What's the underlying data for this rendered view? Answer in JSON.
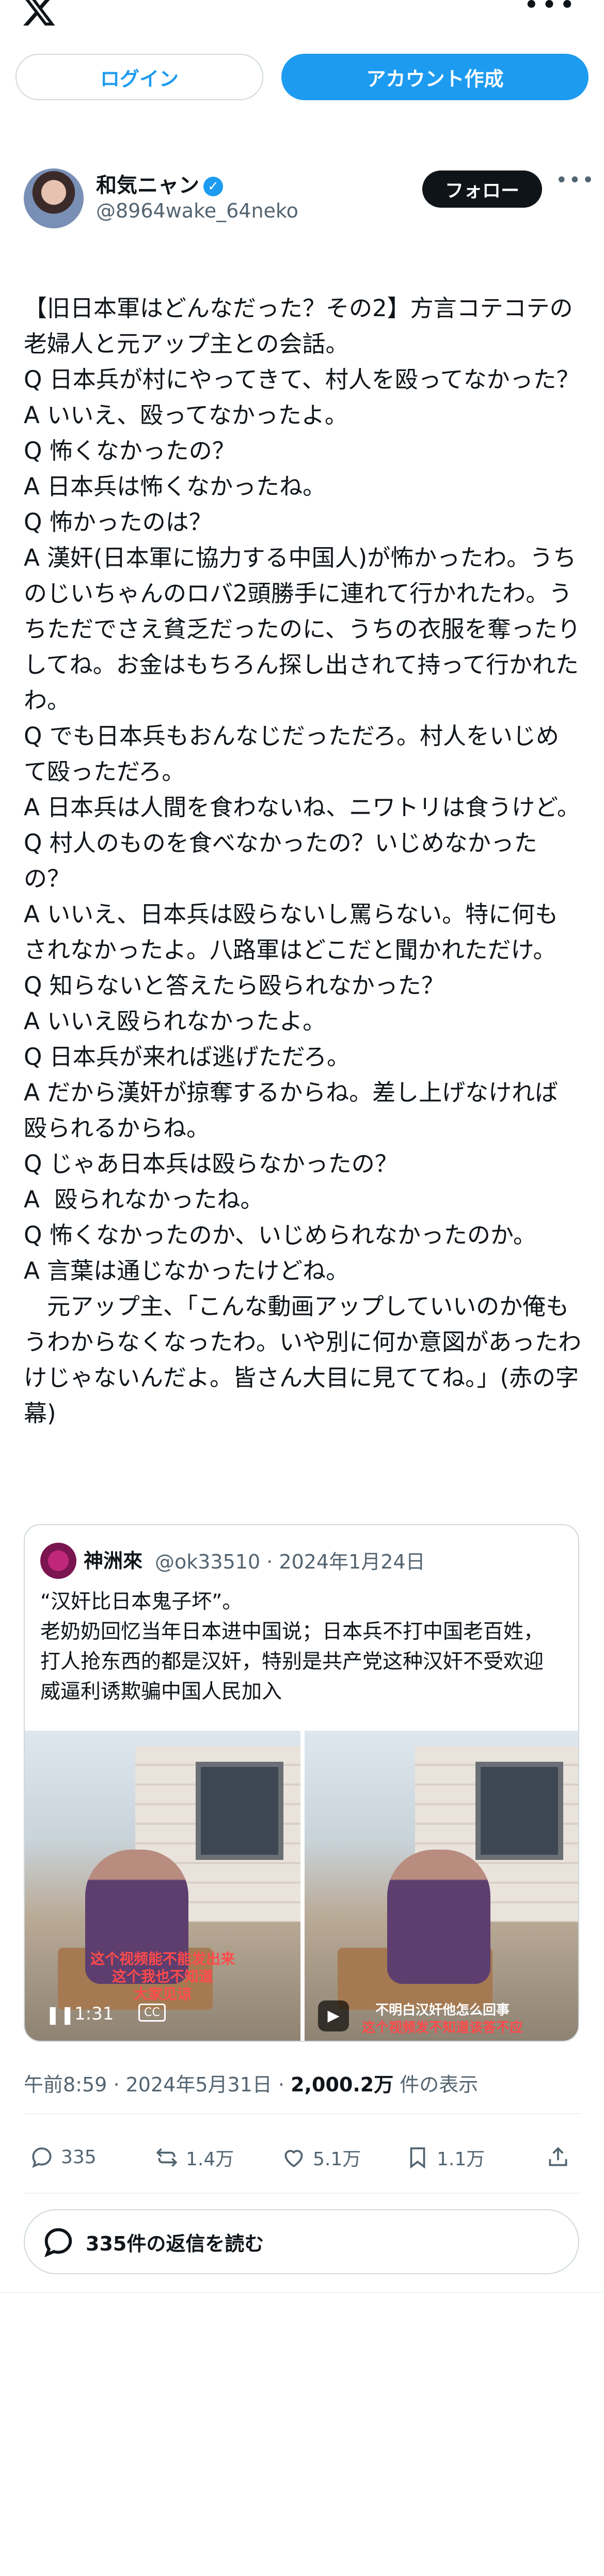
{
  "header": {
    "logo_icon": "x-logo",
    "more_icon": "more-horizontal-icon",
    "login_label": "ログイン",
    "signup_label": "アカウント作成"
  },
  "post": {
    "author_name": "和気ニャン",
    "author_handle": "@8964wake_64neko",
    "verified_icon": "verified-badge-icon",
    "follow_label": "フォロー",
    "more_icon": "more-horizontal-icon",
    "text": "【旧日本軍はどんなだった？その2】方言コテコテの老婦人と元アップ主との会話。\nQ 日本兵が村にやってきて、村人を殴ってなかった？\nA いいえ、殴ってなかったよ。\nQ 怖くなかったの？\nA 日本兵は怖くなかったね。\nQ 怖かったのは？\nA 漢奸(日本軍に協力する中国人)が怖かったわ。うちのじいちゃんのロバ2頭勝手に連れて行かれたわ。うちただでさえ貧乏だったのに、うちの衣服を奪ったりしてね。お金はもちろん探し出されて持って行かれたわ。\nQ でも日本兵もおんなじだっただろ。村人をいじめて殴っただろ。\nA 日本兵は人間を食わないね、ニワトリは食うけど。\nQ 村人のものを食べなかったの？いじめなかったの？\nA いいえ、日本兵は殴らないし罵らない。特に何もされなかったよ。八路軍はどこだと聞かれただけ。\nQ 知らないと答えたら殴られなかった？\nA いいえ殴られなかったよ。\nQ 日本兵が来れば逃げただろ。\nA だから漢奸が掠奪するからね。差し上げなければ殴られるからね。\nQ じゃあ日本兵は殴らなかったの？\nA  殴られなかったね。\nQ 怖くなかったのか、いじめられなかったのか。\nA 言葉は通じなかったけどね。\n　元アップ主、「こんな動画アップしていいのか俺もうわからなくなったわ。いや別に何か意図があったわけじゃないんだよ。皆さん大目に見ててね。」(赤の字幕)",
    "quote": {
      "name": "神洲來",
      "handle": "@ok33510",
      "date": "2024年1月24日",
      "text": "“汉奸比日本鬼子坏”。\n老奶奶回忆当年日本进中国说；日本兵不打中国老百姓，打人抢东西的都是汉奸，特别是共产党这种汉奸不受欢迎威逼利诱欺骗中国人民加入",
      "video1": {
        "time": "1:31",
        "cc_label": "CC",
        "caption_lines": [
          "这个视频能不能发出来",
          "这个我也不知道",
          "大家见谅"
        ]
      },
      "video2": {
        "caption_lines": [
          "不明白汉奸他怎么回事",
          "这个视频发不知道该答不应"
        ]
      }
    },
    "meta": {
      "time": "午前8:59",
      "date": "2024年5月31日",
      "views_value": "2,000.2万",
      "views_suffix": "件の表示"
    },
    "actions": {
      "replies": "335",
      "reposts": "1.4万",
      "likes": "5.1万",
      "bookmarks": "1.1万"
    },
    "read_replies_label": "335件の返信を読む"
  },
  "colors": {
    "accent": "#1d9bf0",
    "text": "#0f1419",
    "secondary": "#536471",
    "border": "#cfd9de"
  }
}
